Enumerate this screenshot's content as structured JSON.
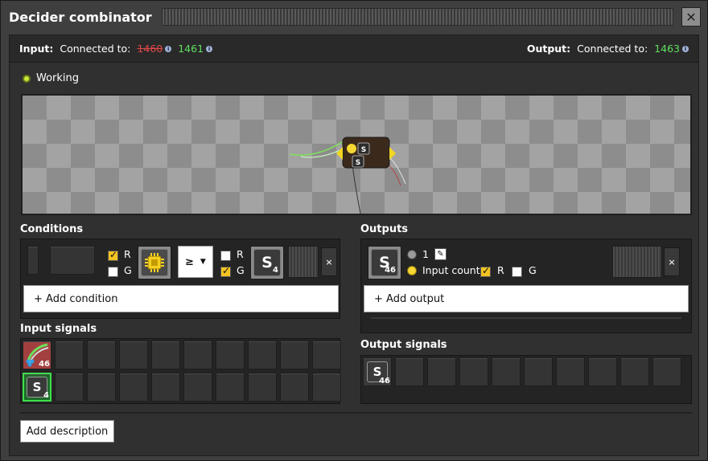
{
  "window": {
    "title": "Decider combinator"
  },
  "connection": {
    "input_label": "Input:",
    "input_connected_label": "Connected to:",
    "input_red_id": "1460",
    "input_green_id": "1461",
    "output_label": "Output:",
    "output_connected_label": "Connected to:",
    "output_green_id": "1463",
    "info_glyph": "i"
  },
  "status": {
    "text": "Working"
  },
  "conditions": {
    "label": "Conditions",
    "left_red_label": "R",
    "left_red_checked": true,
    "left_green_label": "G",
    "left_green_checked": false,
    "operator": "≥",
    "right_red_label": "R",
    "right_red_checked": false,
    "right_green_label": "G",
    "right_green_checked": true,
    "right_signal_letter": "S",
    "right_signal_count": "4",
    "remove_glyph": "×",
    "add_label": "+ Add condition"
  },
  "outputs": {
    "label": "Outputs",
    "signal_letter": "S",
    "signal_count": "46",
    "constant_value": "1",
    "input_count_label": "Input count",
    "red_label": "R",
    "red_checked": true,
    "green_label": "G",
    "green_checked": false,
    "remove_glyph": "×",
    "add_label": "+ Add output"
  },
  "input_signals": {
    "label": "Input signals",
    "items": [
      {
        "icon": "wire-icon",
        "count": "46"
      },
      {
        "icon": "signal-s-icon",
        "letter": "S",
        "count": "4"
      }
    ]
  },
  "output_signals": {
    "label": "Output signals",
    "items": [
      {
        "icon": "signal-s-icon",
        "letter": "S",
        "count": "46"
      }
    ]
  },
  "preview": {
    "signal_letter": "S"
  },
  "footer": {
    "add_description_label": "Add description"
  },
  "colors": {
    "red": "#e04848",
    "green": "#5ee05e",
    "accent": "#f2c322",
    "working": "#c8ea38"
  }
}
